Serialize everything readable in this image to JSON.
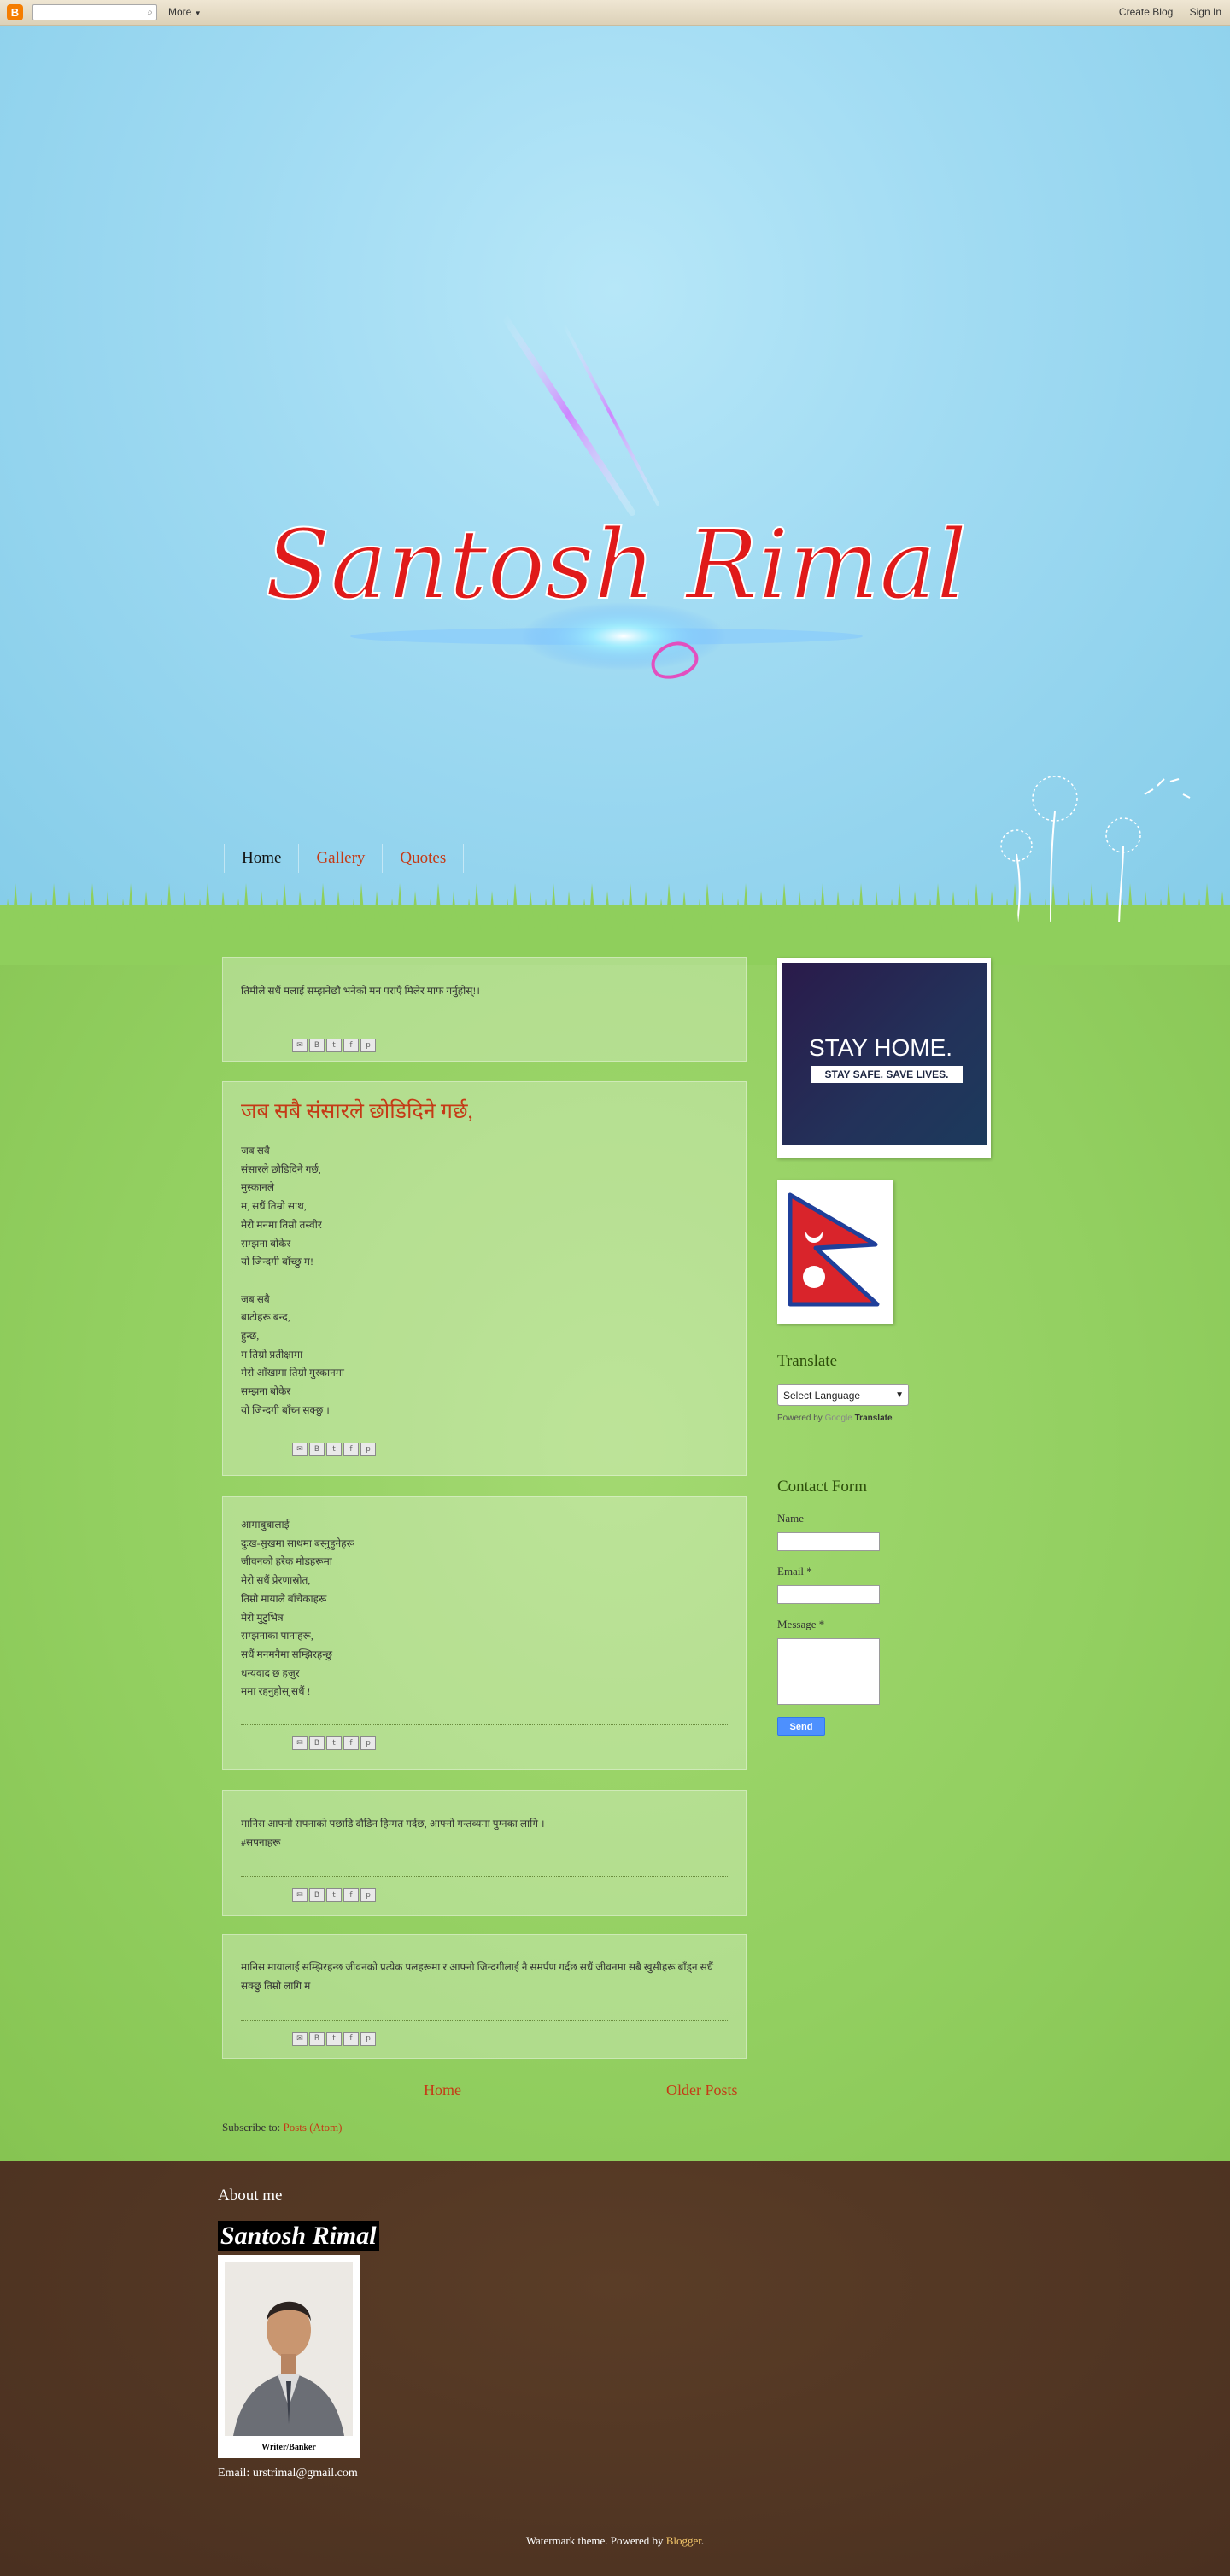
{
  "navbar": {
    "more_label": "More",
    "create_blog": "Create Blog",
    "sign_in": "Sign In",
    "logo": "B"
  },
  "header": {
    "logo_text": "Santosh Rimal"
  },
  "tabs": [
    {
      "label": "Home"
    },
    {
      "label": "Gallery"
    },
    {
      "label": "Quotes"
    }
  ],
  "posts": [
    {
      "title": "",
      "lines": [
        "तिमीले सधैं मलाई सम्झनेछौ भनेको मन पराएँ मिलेर माफ गर्नुहोस्!।"
      ]
    },
    {
      "title": "जब सबै संसारले छोडिदिने गर्छ,",
      "lines": [
        "जब सबै",
        "संसारले छोडिदिने गर्छ,",
        "मुस्कानले",
        " म, सधैं तिम्रो साथ,",
        "मेरो मनमा तिम्रो तस्वीर",
        "सम्झना बोकेर",
        "यो जिन्दगी बाँच्छु म!",
        "",
        "जब सबै",
        "बाटोहरू बन्द,",
        "हुन्छ,",
        "म तिम्रो प्रतीक्षामा",
        "मेरो आँखामा तिम्रो मुस्कानमा",
        "सम्झना बोकेर",
        "यो जिन्दगी बाँच्न सक्छु ।"
      ]
    },
    {
      "title": "",
      "lines": [
        "आमाबुबालाई",
        "दुःख-सुखमा साथमा बस्नुहुनेहरू",
        "जीवनको हरेक मोडहरूमा",
        "मेरो सधैं प्रेरणास्रोत,",
        "तिम्रो मायाले बाँचेकाहरू",
        "मेरो मुटुभित्र",
        "सम्झनाका पानाहरू,",
        "सधैं मनमनैमा सम्झिरहन्छु",
        "धन्यवाद छ हजुर",
        "ममा रहनुहोस् सधैं !"
      ]
    },
    {
      "title": "",
      "lines": [
        "मानिस आफ्नो सपनाको पछाडि दौडिन हिम्मत गर्दछ, आफ्नो गन्तव्यमा पुग्नका लागि ।",
        "#सपनाहरू"
      ]
    },
    {
      "title": "",
      "lines": [
        "मानिस मायालाई सम्झिरहन्छ जीवनको प्रत्येक पलहरूमा र आफ्नो जिन्दगीलाई नै समर्पण गर्दछ सधैं जीवनमा सबै खुसीहरू बाँड्न सधैं",
        "सक्छु तिम्रो लागि म"
      ]
    }
  ],
  "share_icons": [
    "email-icon",
    "blogthis-icon",
    "twitter-icon",
    "facebook-icon",
    "pinterest-icon"
  ],
  "pager": {
    "home": "Home",
    "older": "Older Posts"
  },
  "subscribe": {
    "label": "Subscribe to:",
    "link": "Posts (Atom)"
  },
  "sidebar": {
    "stay_title": "STAY HOME.",
    "stay_sub": "STAY SAFE. SAVE LIVES.",
    "translate_title": "Translate",
    "select_label": "Select Language",
    "powered_by": "Powered by",
    "google": "Google",
    "translate_link": "Translate",
    "contact_title": "Contact Form",
    "name_label": "Name",
    "email_label": "Email",
    "message_label": "Message",
    "required_mark": "*",
    "send_label": "Send"
  },
  "footer": {
    "about_title": "About me",
    "name": "Santosh Rimal",
    "caption": "Writer/Banker",
    "email": "Email: urstrimal@gmail.com",
    "credit_prefix": "Watermark theme. Powered by",
    "credit_link": "Blogger",
    "credit_suffix": "."
  },
  "colors": {
    "accent": "#c53a16",
    "sky": "#9fdaf2",
    "grass": "#92cf60",
    "footer": "#4e3422"
  }
}
